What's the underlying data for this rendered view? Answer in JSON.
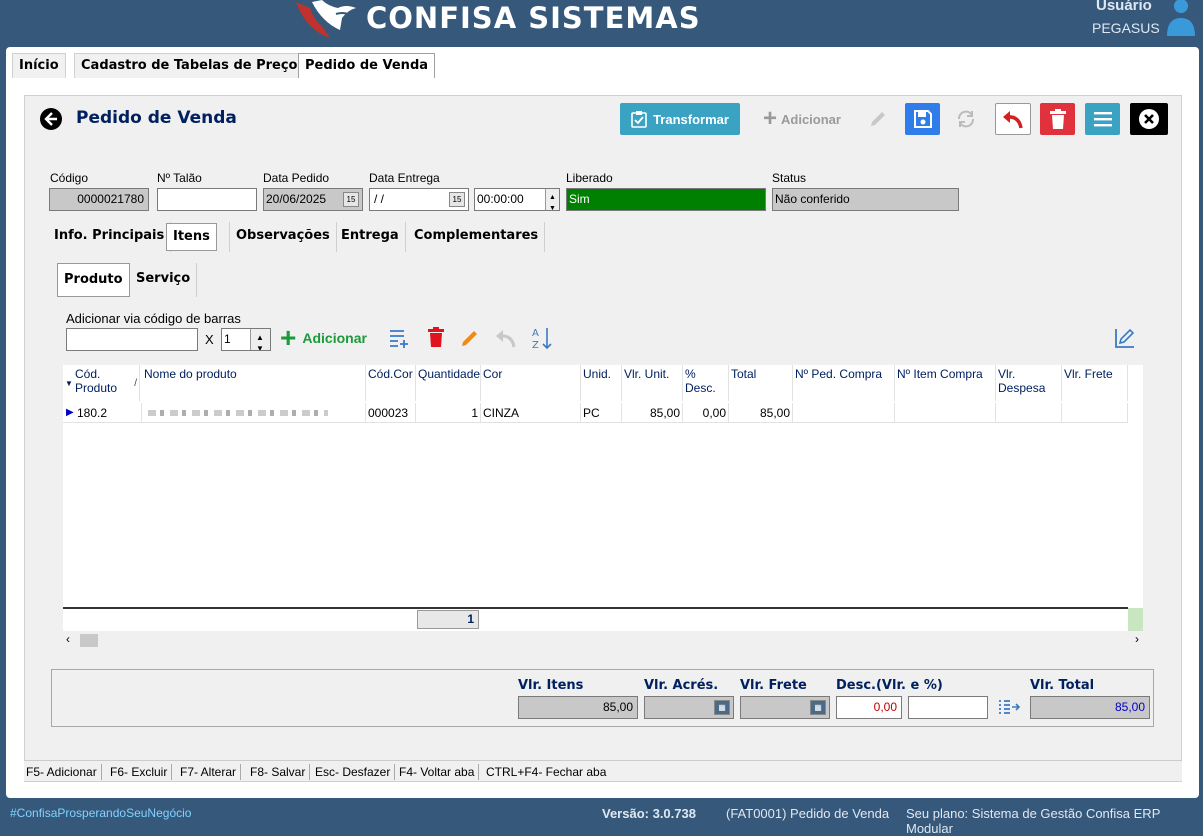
{
  "header": {
    "app_title": "CONFISA SISTEMAS",
    "user_label": "Usuário",
    "user_name": "PEGASUS"
  },
  "top_tabs": [
    "Início",
    "Cadastro de Tabelas de Preços",
    "Pedido de Venda"
  ],
  "page": {
    "title": "Pedido de Venda",
    "transform_label": "Transformar",
    "add_label": "Adicionar"
  },
  "form": {
    "codigo_label": "Código",
    "codigo_value": "0000021780",
    "talao_label": "Nº Talão",
    "talao_value": "",
    "data_pedido_label": "Data Pedido",
    "data_pedido_value": "20/06/2025",
    "data_entrega_label": "Data Entrega",
    "data_entrega_value": " / /",
    "hora_value": "00:00:00",
    "liberado_label": "Liberado",
    "liberado_value": "Sim",
    "status_label": "Status",
    "status_value": "Não conferido"
  },
  "section_tabs": [
    "Info. Principais",
    "Itens",
    "Observações",
    "Entrega",
    "Complementares"
  ],
  "item_tabs": [
    "Produto",
    "Serviço"
  ],
  "barcode": {
    "label": "Adicionar via código de barras",
    "value": "",
    "x_label": "X",
    "qty": "1",
    "add_label": "Adicionar"
  },
  "grid": {
    "columns": [
      "Cód. Produto",
      "Nome do produto",
      "Cód.Cor",
      "Quantidade",
      "Cor",
      "Unid.",
      "Vlr. Unit.",
      "% Desc.",
      "Total",
      "Nº Ped. Compra",
      "Nº Item Compra",
      "Vlr. Despesa",
      "Vlr. Frete"
    ],
    "rows": [
      {
        "cod": "180.2",
        "nome": "",
        "codcor": "000023",
        "qtd": "1",
        "cor": "CINZA",
        "unid": "PC",
        "vlr_unit": "85,00",
        "desc": "0,00",
        "total": "85,00"
      }
    ],
    "footer_count": "1"
  },
  "totals": {
    "vlr_itens_label": "Vlr. Itens",
    "vlr_itens": "85,00",
    "vlr_acres_label": "Vlr. Acrés.",
    "vlr_frete_label": "Vlr. Frete",
    "desc_label": "Desc.(Vlr. e %)",
    "desc_value": "0,00",
    "desc_pct": "",
    "vlr_total_label": "Vlr. Total",
    "vlr_total": "85,00"
  },
  "shortcuts": [
    "F5- Adicionar",
    "F6- Excluir",
    "F7- Alterar",
    "F8- Salvar",
    "Esc- Desfazer",
    "F4- Voltar aba",
    "CTRL+F4- Fechar aba"
  ],
  "footer": {
    "tag": "#ConfisaProsperandoSeuNegócio",
    "version": "Versão: 3.0.738",
    "form": "(FAT0001) Pedido de Venda",
    "plan": "Seu plano: Sistema de Gestão Confisa ERP Modular"
  },
  "colors": {
    "background": "#36587a",
    "liberado_bg": "#008000",
    "accent": "#3aa3c4",
    "save": "#2e7dea",
    "delete": "#e0323c",
    "title": "#002060"
  }
}
